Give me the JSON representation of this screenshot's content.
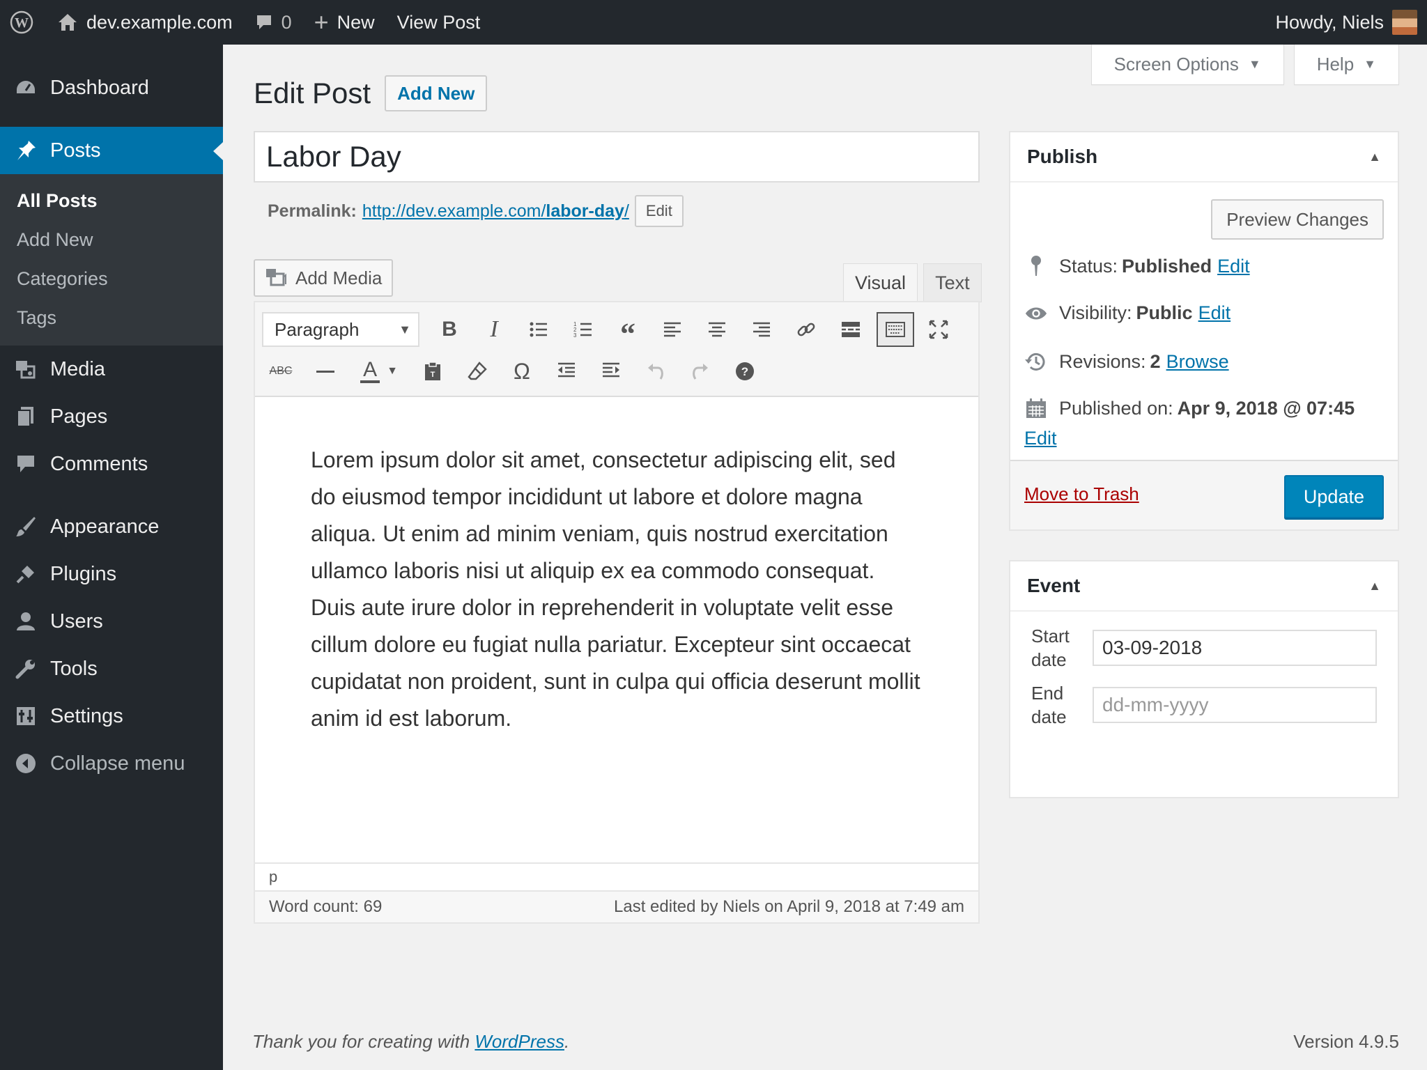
{
  "adminbar": {
    "site_name": "dev.example.com",
    "comments_count": "0",
    "new_label": "New",
    "view_post_label": "View Post",
    "howdy": "Howdy, Niels"
  },
  "menu": {
    "items": [
      {
        "label": "Dashboard",
        "icon": "dashboard-icon"
      },
      {
        "label": "Posts",
        "icon": "pushpin-icon"
      },
      {
        "label": "Media",
        "icon": "media-icon"
      },
      {
        "label": "Pages",
        "icon": "pages-icon"
      },
      {
        "label": "Comments",
        "icon": "comment-icon"
      },
      {
        "label": "Appearance",
        "icon": "paintbrush-icon"
      },
      {
        "label": "Plugins",
        "icon": "plug-icon"
      },
      {
        "label": "Users",
        "icon": "user-icon"
      },
      {
        "label": "Tools",
        "icon": "wrench-icon"
      },
      {
        "label": "Settings",
        "icon": "settings-icon"
      },
      {
        "label": "Collapse menu",
        "icon": "collapse-icon"
      }
    ],
    "posts_submenu": [
      "All Posts",
      "Add New",
      "Categories",
      "Tags"
    ]
  },
  "screen_options": {
    "screen_options_label": "Screen Options",
    "help_label": "Help"
  },
  "page": {
    "title": "Edit Post",
    "add_new_label": "Add New"
  },
  "post": {
    "title": "Labor Day",
    "permalink_label": "Permalink:",
    "permalink_base": "http://dev.example.com/",
    "permalink_slug": "labor-day",
    "permalink_trailing": "/",
    "permalink_edit": "Edit"
  },
  "editor": {
    "add_media_label": "Add Media",
    "tab_visual": "Visual",
    "tab_text": "Text",
    "format_value": "Paragraph",
    "content": "Lorem ipsum dolor sit amet, consectetur adipiscing elit, sed do eiusmod tempor incididunt ut labore et dolore magna aliqua. Ut enim ad minim veniam, quis nostrud exercitation ullamco laboris nisi ut aliquip ex ea commodo consequat. Duis aute irure dolor in reprehenderit in voluptate velit esse cillum dolore eu fugiat nulla pariatur. Excepteur sint occaecat cupidatat non proident, sunt in culpa qui officia deserunt mollit anim id est laborum.",
    "path": "p",
    "word_count": "Word count: 69",
    "last_edited": "Last edited by Niels on April 9, 2018 at 7:49 am"
  },
  "publish": {
    "title": "Publish",
    "preview_label": "Preview Changes",
    "status_label": "Status:",
    "status_value": "Published",
    "visibility_label": "Visibility:",
    "visibility_value": "Public",
    "revisions_label": "Revisions:",
    "revisions_value": "2",
    "browse_label": "Browse",
    "published_on_label": "Published on:",
    "published_on_value": "Apr 9, 2018 @ 07:45",
    "edit_label": "Edit",
    "trash_label": "Move to Trash",
    "update_label": "Update"
  },
  "event": {
    "title": "Event",
    "start_label_1": "Start",
    "start_label_2": "date",
    "start_value": "03-09-2018",
    "end_label_1": "End",
    "end_label_2": "date",
    "end_placeholder": "dd-mm-yyyy"
  },
  "footer": {
    "thanks_prefix": "Thank you for creating with",
    "wordpress_link": "WordPress",
    "thanks_suffix": ".",
    "version": "Version 4.9.5"
  },
  "colors": {
    "accent": "#0073aa",
    "primary_button": "#0085ba",
    "menu_bg": "#23282d",
    "trash": "#a00"
  }
}
